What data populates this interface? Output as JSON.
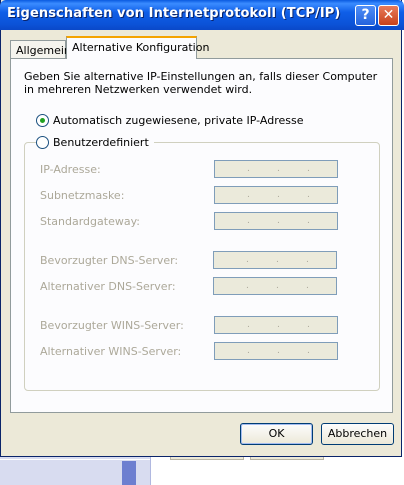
{
  "window": {
    "title": "Eigenschaften von Internetprotokoll (TCP/IP)",
    "help_glyph": "?",
    "close_glyph": "✕"
  },
  "tabs": [
    {
      "label": "Allgemein",
      "active": false
    },
    {
      "label": "Alternative Konfiguration",
      "active": true
    }
  ],
  "description": "Geben Sie alternative IP-Einstellungen an, falls dieser Computer in mehreren Netzwerken verwendet wird.",
  "options": {
    "auto_label": "Automatisch zugewiesene, private IP-Adresse",
    "auto_selected": true,
    "user_label": "Benutzerdefiniert",
    "user_selected": false
  },
  "fields": [
    {
      "label": "IP-Adresse:"
    },
    {
      "label": "Subnetzmaske:"
    },
    {
      "label": "Standardgateway:"
    },
    {
      "label": "Bevorzugter DNS-Server:"
    },
    {
      "label": "Alternativer DNS-Server:"
    },
    {
      "label": "Bevorzugter WINS-Server:"
    },
    {
      "label": "Alternativer WINS-Server:"
    }
  ],
  "buttons": {
    "ok": "OK",
    "cancel": "Abbrechen"
  }
}
